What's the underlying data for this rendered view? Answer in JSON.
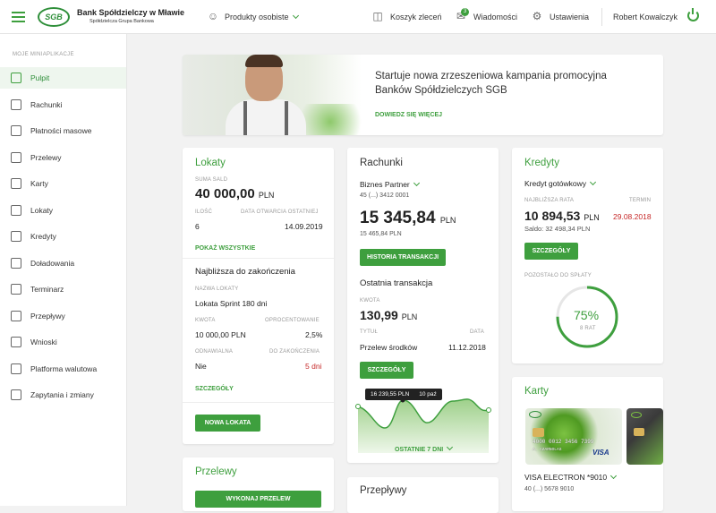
{
  "header": {
    "bank_name": "Bank Spółdzielczy w Mławie",
    "bank_sub": "Spółdzielcza Grupa Bankowa",
    "logo": "SGB",
    "products": "Produkty osobiste",
    "cart": "Koszyk zleceń",
    "messages": "Wiadomości",
    "messages_badge": "3",
    "settings": "Ustawienia",
    "user": "Robert Kowalczyk"
  },
  "sidebar": {
    "heading": "MOJE MINIAPLIKACJE",
    "items": [
      {
        "label": "Pulpit",
        "icon": "dashboard-icon"
      },
      {
        "label": "Rachunki",
        "icon": "wallet-icon"
      },
      {
        "label": "Płatności masowe",
        "icon": "coins-icon"
      },
      {
        "label": "Przelewy",
        "icon": "transfer-icon"
      },
      {
        "label": "Karty",
        "icon": "card-icon"
      },
      {
        "label": "Lokaty",
        "icon": "piggy-bank-icon"
      },
      {
        "label": "Kredyty",
        "icon": "credit-icon"
      },
      {
        "label": "Doładowania",
        "icon": "phone-icon"
      },
      {
        "label": "Terminarz",
        "icon": "calendar-icon"
      },
      {
        "label": "Przepływy",
        "icon": "flow-icon"
      },
      {
        "label": "Wnioski",
        "icon": "form-icon"
      },
      {
        "label": "Platforma walutowa",
        "icon": "currency-icon"
      },
      {
        "label": "Zapytania i zmiany",
        "icon": "question-icon"
      }
    ]
  },
  "banner": {
    "title": "Startuje nowa zrzeszeniowa kampania promocyjna Banków Spółdzielczych SGB",
    "link": "DOWIEDZ SIĘ WIĘCEJ"
  },
  "lokaty": {
    "title": "Lokaty",
    "sum_label": "SUMA SALD",
    "sum": "40 000,00",
    "currency": "PLN",
    "count_label": "ILOŚĆ",
    "date_label": "DATA OTWARCIA OSTATNIEJ",
    "count": "6",
    "date": "14.09.2019",
    "show_all": "POKAŻ WSZYSTKIE",
    "nearest": "Najbliższa do zakończenia",
    "name_label": "NAZWA LOKATY",
    "name": "Lokata Sprint 180 dni",
    "amount_label": "KWOTA",
    "rate_label": "OPROCENTOWANIE",
    "amount": "10 000,00 PLN",
    "rate": "2,5%",
    "renew_label": "ODNAWIALNA",
    "end_label": "DO ZAKOŃCZENIA",
    "renew": "Nie",
    "end": "5 dni",
    "details": "SZCZEGÓŁY",
    "new_btn": "NOWA LOKATA"
  },
  "rachunki": {
    "title": "Rachunki",
    "account": "Biznes Partner",
    "number": "45 (...) 3412 0001",
    "balance": "15 345,84",
    "currency": "PLN",
    "available": "15 465,84 PLN",
    "history_btn": "HISTORIA TRANSAKCJI",
    "last_title": "Ostatnia transakcja",
    "amount_label": "KWOTA",
    "amount": "130,99",
    "title_label": "TYTUŁ",
    "date_label": "DATA",
    "tx_title": "Przelew środków",
    "tx_date": "11.12.2018",
    "details": "SZCZEGÓŁY",
    "tooltip_value": "16 239,55 PLN",
    "tooltip_date": "10 paź",
    "period": "OSTATNIE 7 DNI"
  },
  "kredyty": {
    "title": "Kredyty",
    "product": "Kredyt gotówkowy",
    "rate_label": "NAJBLIŻSZA RATA",
    "term_label": "TERMIN",
    "rate": "10 894,53",
    "currency": "PLN",
    "term": "29.08.2018",
    "balance": "Saldo: 32 498,34 PLN",
    "details": "SZCZEGÓŁY",
    "remaining_label": "POZOSTAŁO DO SPŁATY",
    "percent": "75%",
    "percent_value": 0.75,
    "installments": "8 RAT"
  },
  "karty": {
    "title": "Karty",
    "card_name": "VISA ELECTRON *9010",
    "card_number": "40 (...) 5678 9010",
    "card_pan": "4000 0012 3456 7399",
    "card_brand": "VISA",
    "card_holder": "A. CZARNOLAS"
  },
  "przelewy": {
    "title": "Przelewy",
    "btn": "WYKONAJ PRZELEW"
  },
  "przeplywy": {
    "title": "Przepływy"
  },
  "colors": {
    "accent": "#3e9f3e",
    "danger": "#c62828"
  }
}
